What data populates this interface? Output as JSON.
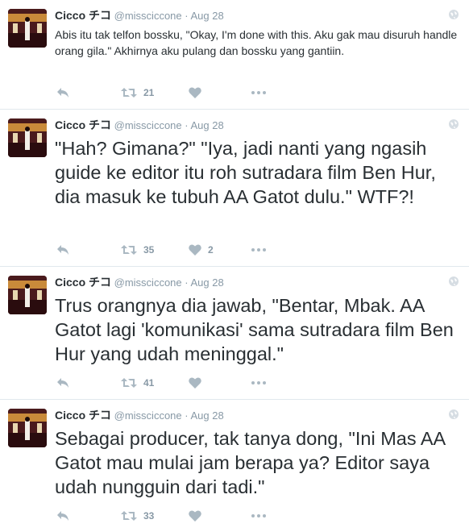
{
  "colors": {
    "text": "#292f33",
    "muted": "#8899a6",
    "divider": "#e1e8ed",
    "icon": "#aab8c2"
  },
  "icons": {
    "reply": "reply-icon",
    "retweet": "retweet-icon",
    "like": "heart-icon",
    "more": "more-icon",
    "globe": "globe-icon"
  },
  "tweets": [
    {
      "name": "Cicco チコ",
      "handle": "@missciccone",
      "dot": "·",
      "time": "Aug 28",
      "text": "Abis itu tak telfon bossku, \"Okay, I'm done with this. Aku gak mau disuruh handle orang gila.\" Akhirnya aku pulang dan bossku yang gantiin.",
      "retweets": "21",
      "likes": ""
    },
    {
      "name": "Cicco チコ",
      "handle": "@missciccone",
      "dot": "·",
      "time": "Aug 28",
      "text": "\"Hah? Gimana?\" \"Iya, jadi nanti yang ngasih guide ke editor itu roh sutradara film Ben Hur, dia masuk ke tubuh AA Gatot dulu.\" WTF?!",
      "retweets": "35",
      "likes": "2"
    },
    {
      "name": "Cicco チコ",
      "handle": "@missciccone",
      "dot": "·",
      "time": "Aug 28",
      "text": "Trus orangnya dia jawab, \"Bentar, Mbak. AA Gatot lagi 'komunikasi' sama sutradara film Ben Hur yang udah meninggal.\"",
      "retweets": "41",
      "likes": ""
    },
    {
      "name": "Cicco チコ",
      "handle": "@missciccone",
      "dot": "·",
      "time": "Aug 28",
      "text": "Sebagai producer, tak tanya dong, \"Ini Mas AA Gatot mau mulai jam berapa ya? Editor saya udah nungguin dari tadi.\"",
      "retweets": "33",
      "likes": ""
    }
  ]
}
